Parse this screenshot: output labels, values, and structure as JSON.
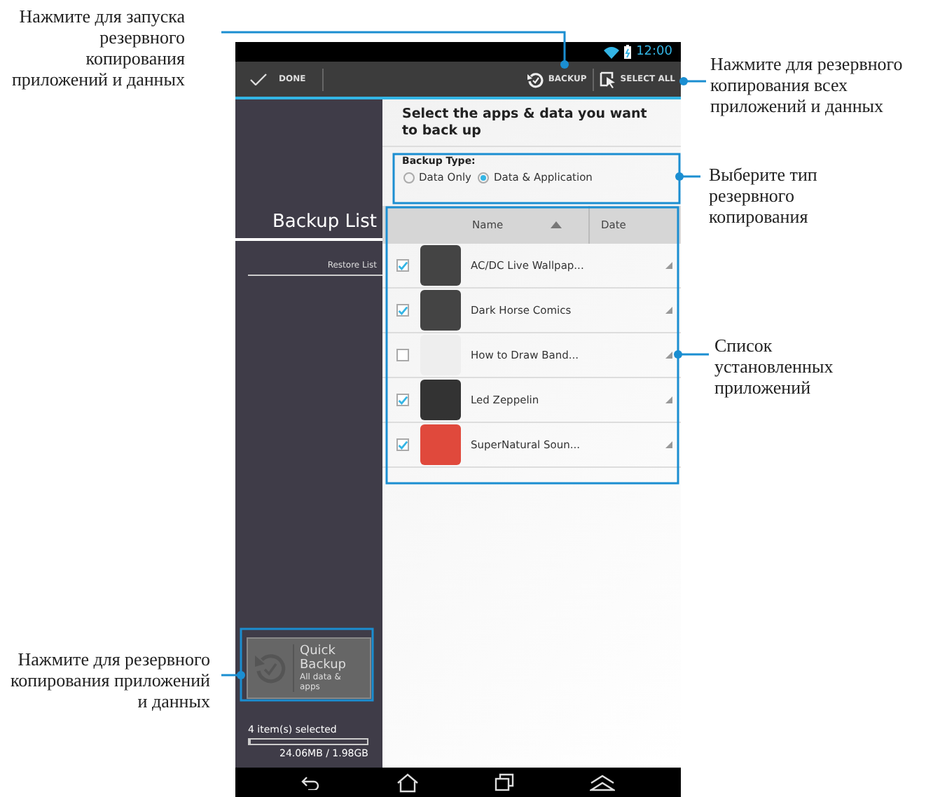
{
  "callouts": [
    {
      "text": "Нажмите для запуска резервного копирования приложений и данных"
    },
    {
      "text": "Нажмите для резервного копирования всех приложений и данных"
    },
    {
      "text": "Выберите тип резервного копирования"
    },
    {
      "text": "Список установленных приложений"
    },
    {
      "text": "Нажмите для резервного копирования приложений и данных"
    }
  ],
  "status_bar": {
    "time": "12:00"
  },
  "action_bar": {
    "done": "DONE",
    "backup": "BACKUP",
    "select_all": "SELECT ALL"
  },
  "sidebar": {
    "tabs": [
      {
        "label": "Backup List",
        "selected": true
      },
      {
        "label": "Restore List",
        "selected": false
      }
    ],
    "quick_backup": {
      "title": "Quick Backup",
      "subtitle": "All data & apps",
      "disabled": true
    },
    "selection": "4 item(s) selected",
    "storage": {
      "level": 0.01,
      "reading": "24.06MB / 1.98GB"
    }
  },
  "heading": "Select the apps & data you want to back up",
  "backup_type": {
    "label": "Backup Type:",
    "options": [
      {
        "label": "Data Only",
        "selected": false
      },
      {
        "label": "Data & Application",
        "selected": true
      }
    ]
  },
  "table": {
    "columns": [
      {
        "label": "Name",
        "sorted": true
      },
      {
        "label": "Date",
        "sorted": false
      }
    ],
    "rows": [
      {
        "name": "AC/DC Live Wallpap...",
        "checked": true
      },
      {
        "name": "Dark Horse Comics",
        "checked": true
      },
      {
        "name": "How to Draw Band...",
        "checked": false
      },
      {
        "name": "Led Zeppelin",
        "checked": true
      },
      {
        "name": "SuperNatural Soun...",
        "checked": true
      }
    ]
  }
}
